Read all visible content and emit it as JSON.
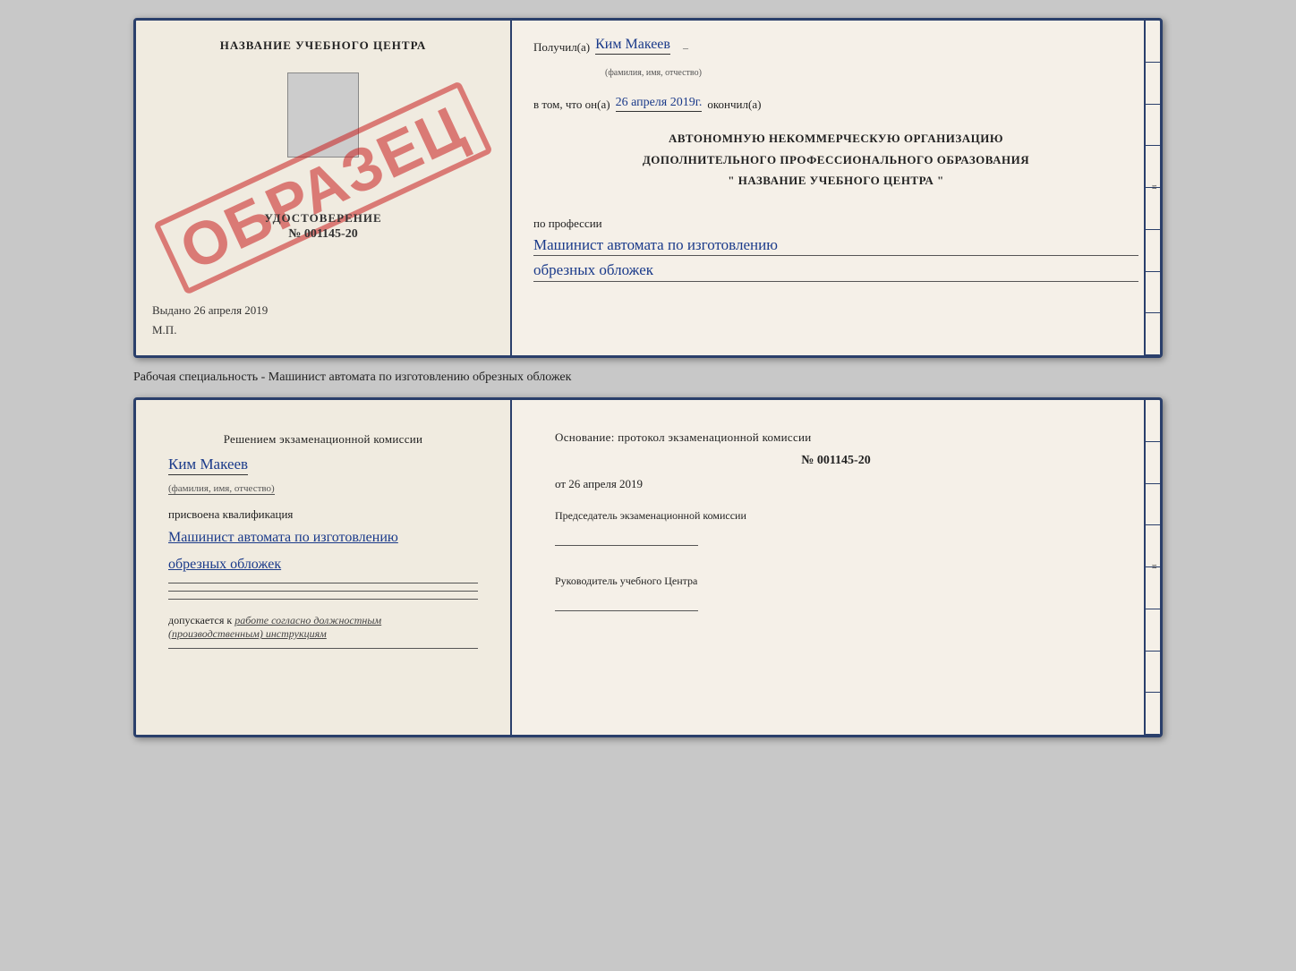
{
  "top_card": {
    "left": {
      "title": "НАЗВАНИЕ УЧЕБНОГО ЦЕНТРА",
      "stamp": "ОБРАЗЕЦ",
      "udost_label": "УДОСТОВЕРЕНИЕ",
      "udost_number": "№ 001145-20",
      "vydano_label": "Выдано",
      "vydano_date": "26 апреля 2019",
      "mp_label": "М.П."
    },
    "right": {
      "received_label": "Получил(а)",
      "received_name": "Ким Макеев",
      "fio_label": "(фамилия, имя, отчество)",
      "in_that_label": "в том, что он(а)",
      "completion_date": "26 апреля 2019г.",
      "finished_label": "окончил(а)",
      "org_line1": "АВТОНОМНУЮ НЕКОММЕРЧЕСКУЮ ОРГАНИЗАЦИЮ",
      "org_line2": "ДОПОЛНИТЕЛЬНОГО ПРОФЕССИОНАЛЬНОГО ОБРАЗОВАНИЯ",
      "org_line3": "\"   НАЗВАНИЕ УЧЕБНОГО ЦЕНТРА   \"",
      "profession_label": "по профессии",
      "profession_value_line1": "Машинист автомата по изготовлению",
      "profession_value_line2": "обрезных обложек"
    }
  },
  "caption": "Рабочая специальность - Машинист автомата по изготовлению обрезных обложек",
  "bottom_card": {
    "left": {
      "section_title": "Решением экзаменационной комиссии",
      "person_name": "Ким Макеев",
      "fio_label": "(фамилия, имя, отчество)",
      "assigned_label": "присвоена квалификация",
      "profession_line1": "Машинист автомата по изготовлению",
      "profession_line2": "обрезных обложек",
      "allowed_label": "допускается к",
      "allowed_value": "работе согласно должностным (производственным) инструкциям"
    },
    "right": {
      "basis_label": "Основание: протокол экзаменационной комиссии",
      "protocol_number": "№ 001145-20",
      "protocol_date_prefix": "от",
      "protocol_date": "26 апреля 2019",
      "chairman_label": "Председатель экзаменационной комиссии",
      "center_head_label": "Руководитель учебного Центра"
    }
  }
}
